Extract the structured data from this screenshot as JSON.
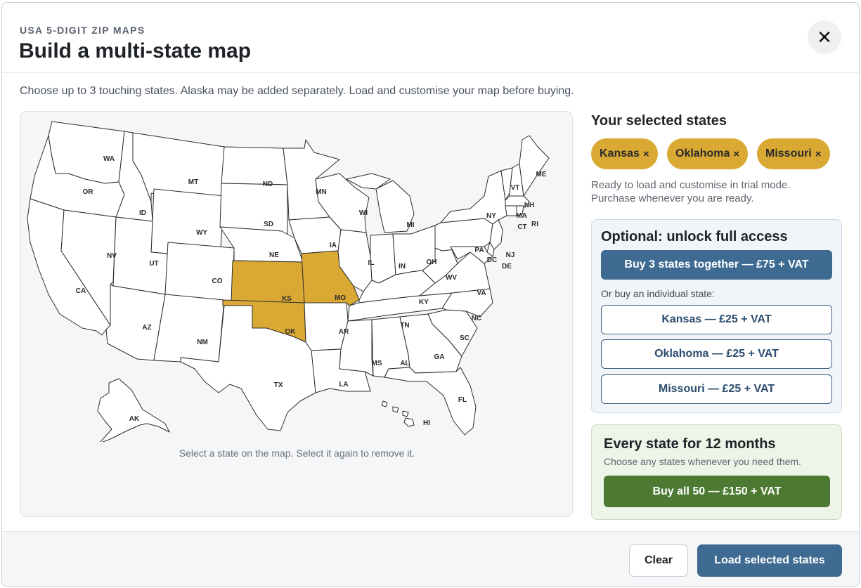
{
  "header": {
    "eyebrow": "USA 5-DIGIT ZIP MAPS",
    "title": "Build a multi-state map",
    "close_label": "✕"
  },
  "instructions": "Choose up to 3 touching states. Alaska may be added separately. Load and customise your map before buying.",
  "map": {
    "hint": "Select a state on the map. Select it again to remove it.",
    "selected_color": "#d9a934",
    "labels": {
      "WA": "WA",
      "OR": "OR",
      "CA": "CA",
      "ID": "ID",
      "NV": "NV",
      "MT": "MT",
      "WY": "WY",
      "UT": "UT",
      "AZ": "AZ",
      "CO": "CO",
      "NM": "NM",
      "ND": "ND",
      "SD": "SD",
      "NE": "NE",
      "KS": "KS",
      "OK": "OK",
      "TX": "TX",
      "MN": "MN",
      "IA": "IA",
      "MO": "MO",
      "AR": "AR",
      "LA": "LA",
      "WI": "WI",
      "IL": "IL",
      "MI": "MI",
      "IN": "IN",
      "OH": "OH",
      "KY": "KY",
      "TN": "TN",
      "MS": "MS",
      "AL": "AL",
      "GA": "GA",
      "FL": "FL",
      "SC": "SC",
      "NC": "NC",
      "VA": "VA",
      "WV": "WV",
      "PA": "PA",
      "NY": "NY",
      "VT": "VT",
      "NH": "NH",
      "ME": "ME",
      "MA": "MA",
      "CT": "CT",
      "RI": "RI",
      "NJ": "NJ",
      "DE": "DE",
      "DC": "DC",
      "AK": "AK",
      "HI": "HI"
    }
  },
  "selection": {
    "title": "Your selected states",
    "chips": [
      "Kansas",
      "Oklahoma",
      "Missouri"
    ],
    "chip_remove": "×",
    "ready_text": "Ready to load and customise in trial mode. Purchase whenever you are ready."
  },
  "unlock": {
    "title": "Optional: unlock full access",
    "bundle_button": "Buy 3 states together — £75 + VAT",
    "or_text": "Or buy an individual state:",
    "individual": [
      "Kansas — £25 + VAT",
      "Oklahoma — £25 + VAT",
      "Missouri — £25 + VAT"
    ]
  },
  "annual": {
    "title": "Every state for 12 months",
    "subtitle": "Choose any states whenever you need them.",
    "button": "Buy all 50 — £150 + VAT"
  },
  "footer": {
    "clear": "Clear",
    "load": "Load selected states"
  },
  "colors": {
    "accent_blue": "#3f6b92",
    "state_selected": "#d9a934",
    "annual_green": "#4d7a32"
  }
}
